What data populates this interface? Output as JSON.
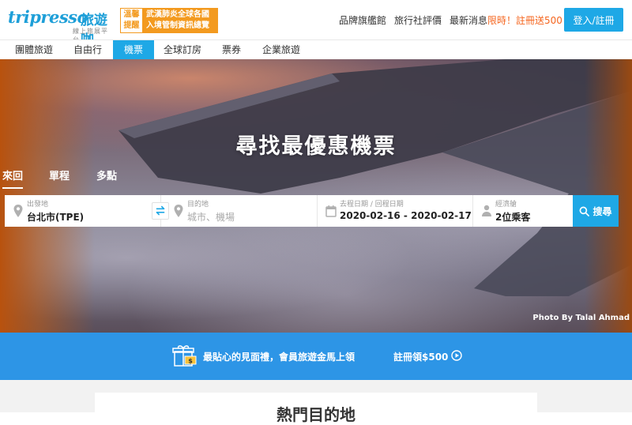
{
  "header": {
    "logo_word": "tripresso",
    "logo_cn": "旅遊咖",
    "logo_sub": "線上旅展平台",
    "notice_tag": "溫馨提醒",
    "notice_text": "武漢肺炎全球各國入境管制資訊總覽",
    "brand_link": "品牌旗艦館",
    "review_link": "旅行社評價",
    "news_prefix": "最新消息",
    "news_highlight": "限時！註冊送500！",
    "login_label": "登入/註冊"
  },
  "tabs": [
    {
      "label": "團體旅遊"
    },
    {
      "label": "自由行"
    },
    {
      "label": "機票"
    },
    {
      "label": "全球訂房"
    },
    {
      "label": "票券"
    },
    {
      "label": "企業旅遊"
    }
  ],
  "active_tab": "機票",
  "hero": {
    "title": "尋找最優惠機票",
    "trip_types": [
      "來回",
      "單程",
      "多點"
    ],
    "active_trip_type": "來回",
    "photo_credit": "Photo By Talal Ahmad"
  },
  "search": {
    "origin_label": "出發地",
    "origin_value": "台北市(TPE)",
    "dest_label": "目的地",
    "dest_placeholder": "城市、機場",
    "date_label": "去程日期 / 回程日期",
    "date_value": "2020-02-16 - 2020-02-17",
    "cabin_label": "經濟艙",
    "cabin_value": "2位乘客",
    "search_label": "搜尋"
  },
  "promo": {
    "text": "最貼心的見面禮，會員旅遊金馬上領",
    "cta": "註冊領$500"
  },
  "popular": {
    "title": "熱門目的地"
  },
  "colors": {
    "brand_blue": "#1ea8e6",
    "promo_blue": "#2d95e6",
    "notice_orange": "#f39a1f",
    "highlight_orange": "#f5651e"
  }
}
